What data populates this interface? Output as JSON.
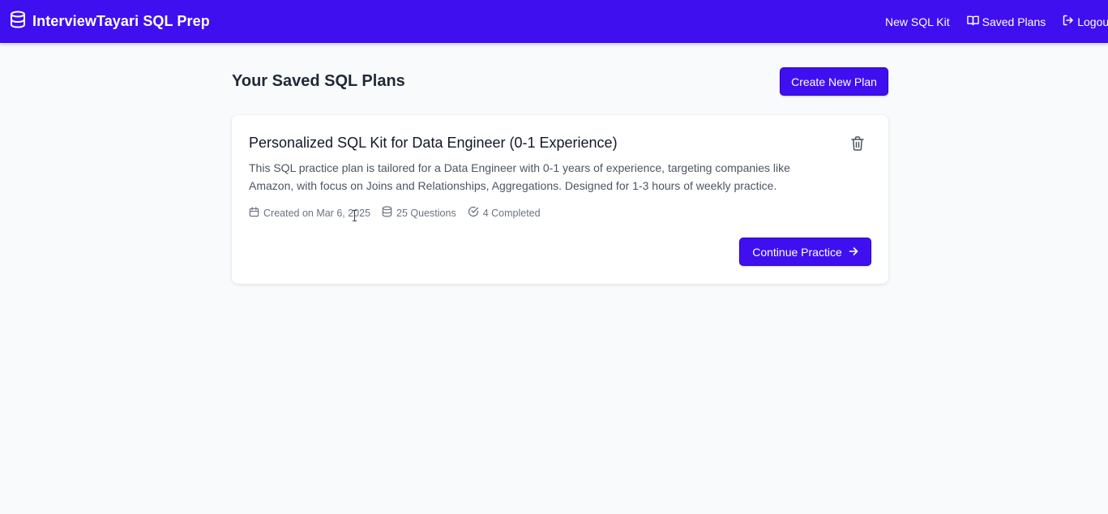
{
  "header": {
    "title": "InterviewTayari SQL Prep",
    "logo_icon": "database-icon",
    "nav": {
      "new_kit": "New SQL Kit",
      "saved_plans": "Saved Plans",
      "logout": "Logout"
    }
  },
  "main": {
    "title": "Your Saved SQL Plans",
    "create_button": "Create New Plan"
  },
  "plans": [
    {
      "title": "Personalized SQL Kit for Data Engineer (0-1 Experience)",
      "description": "This SQL practice plan is tailored for a Data Engineer with 0-1 years of experience, targeting companies like Amazon, with focus on Joins and Relationships, Aggregations. Designed for 1-3 hours of weekly practice.",
      "created": "Created on Mar 6, 2025",
      "questions": "25 Questions",
      "completed": "4 Completed",
      "continue_button": "Continue Practice"
    }
  ],
  "colors": {
    "primary": "#3f0ff0",
    "background": "#f9fafb",
    "card": "#ffffff",
    "muted_text": "#6b7280"
  },
  "icons": [
    "database-icon",
    "book-open-icon",
    "logout-icon",
    "trash-icon",
    "calendar-icon",
    "check-circle-icon",
    "arrow-right-icon",
    "text-cursor-icon"
  ]
}
